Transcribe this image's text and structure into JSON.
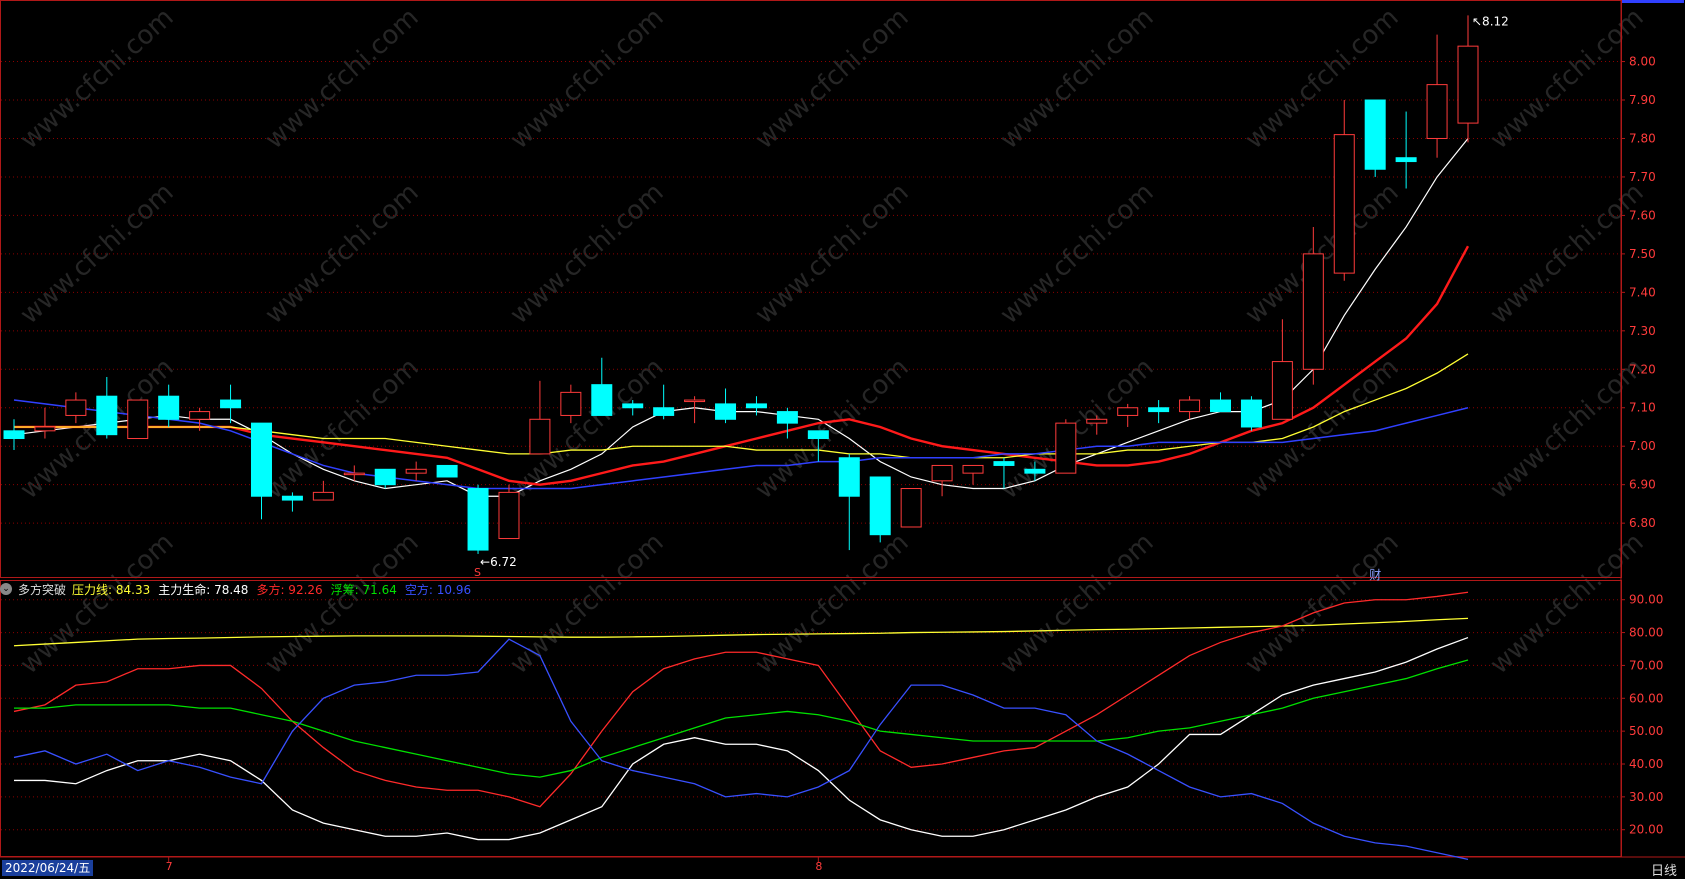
{
  "colors": {
    "up": "#ff3b3b",
    "down": "#00ffff",
    "ma5": "#ffffff",
    "ma10": "#ff1a1a",
    "ma20": "#ffff33",
    "ma60": "#3040ff",
    "grid": "#8b0000",
    "axis": "#b01818"
  },
  "watermark": "www.cfchi.com",
  "indicator": {
    "name": "多方突破",
    "items": [
      {
        "label": "压力线:",
        "value": "84.33",
        "color": "#ffff33"
      },
      {
        "label": "主力生命:",
        "value": "78.48",
        "color": "#ffffff"
      },
      {
        "label": "多方:",
        "value": "92.26",
        "color": "#ff2a2a"
      },
      {
        "label": "浮筹:",
        "value": "71.64",
        "color": "#00e000"
      },
      {
        "label": "空方:",
        "value": "10.96",
        "color": "#3850ff"
      }
    ]
  },
  "footer": {
    "date": "2022/06/24/五",
    "period": "日线",
    "month_labels": [
      "7",
      "8"
    ]
  },
  "markers": {
    "s_label": "S",
    "cai_label": "财",
    "high_label": "8.12",
    "low_label": "6.72"
  },
  "chart_data": [
    {
      "type": "candlestick",
      "title": "",
      "ylim": [
        6.66,
        8.16
      ],
      "y_ticks": [
        8.0,
        7.9,
        7.8,
        7.7,
        7.6,
        7.5,
        7.4,
        7.3,
        7.2,
        7.1,
        7.0,
        6.9,
        6.8
      ],
      "candles": [
        {
          "o": 7.04,
          "h": 7.07,
          "l": 6.99,
          "c": 7.02
        },
        {
          "o": 7.04,
          "h": 7.1,
          "l": 7.02,
          "c": 7.05
        },
        {
          "o": 7.08,
          "h": 7.14,
          "l": 7.06,
          "c": 7.12
        },
        {
          "o": 7.13,
          "h": 7.18,
          "l": 7.02,
          "c": 7.03
        },
        {
          "o": 7.02,
          "h": 7.12,
          "l": 7.02,
          "c": 7.12
        },
        {
          "o": 7.13,
          "h": 7.16,
          "l": 7.05,
          "c": 7.07
        },
        {
          "o": 7.07,
          "h": 7.1,
          "l": 7.04,
          "c": 7.09
        },
        {
          "o": 7.12,
          "h": 7.16,
          "l": 7.06,
          "c": 7.1
        },
        {
          "o": 7.06,
          "h": 7.06,
          "l": 6.81,
          "c": 6.87
        },
        {
          "o": 6.87,
          "h": 6.88,
          "l": 6.83,
          "c": 6.86
        },
        {
          "o": 6.86,
          "h": 6.91,
          "l": 6.86,
          "c": 6.88
        },
        {
          "o": 6.93,
          "h": 6.95,
          "l": 6.91,
          "c": 6.93
        },
        {
          "o": 6.94,
          "h": 6.94,
          "l": 6.89,
          "c": 6.9
        },
        {
          "o": 6.93,
          "h": 6.96,
          "l": 6.91,
          "c": 6.94
        },
        {
          "o": 6.95,
          "h": 6.95,
          "l": 6.92,
          "c": 6.92
        },
        {
          "o": 6.89,
          "h": 6.9,
          "l": 6.72,
          "c": 6.73
        },
        {
          "o": 6.76,
          "h": 6.9,
          "l": 6.76,
          "c": 6.88
        },
        {
          "o": 6.98,
          "h": 7.17,
          "l": 6.98,
          "c": 7.07
        },
        {
          "o": 7.08,
          "h": 7.16,
          "l": 7.06,
          "c": 7.14
        },
        {
          "o": 7.16,
          "h": 7.23,
          "l": 7.08,
          "c": 7.08
        },
        {
          "o": 7.11,
          "h": 7.12,
          "l": 7.08,
          "c": 7.1
        },
        {
          "o": 7.1,
          "h": 7.16,
          "l": 7.07,
          "c": 7.08
        },
        {
          "o": 7.12,
          "h": 7.13,
          "l": 7.06,
          "c": 7.12
        },
        {
          "o": 7.11,
          "h": 7.15,
          "l": 7.06,
          "c": 7.07
        },
        {
          "o": 7.11,
          "h": 7.13,
          "l": 7.08,
          "c": 7.1
        },
        {
          "o": 7.09,
          "h": 7.1,
          "l": 7.02,
          "c": 7.06
        },
        {
          "o": 7.04,
          "h": 7.04,
          "l": 6.96,
          "c": 7.02
        },
        {
          "o": 6.97,
          "h": 6.98,
          "l": 6.73,
          "c": 6.87
        },
        {
          "o": 6.92,
          "h": 6.92,
          "l": 6.75,
          "c": 6.77
        },
        {
          "o": 6.79,
          "h": 6.89,
          "l": 6.79,
          "c": 6.89
        },
        {
          "o": 6.91,
          "h": 6.95,
          "l": 6.87,
          "c": 6.95
        },
        {
          "o": 6.93,
          "h": 6.95,
          "l": 6.9,
          "c": 6.95
        },
        {
          "o": 6.96,
          "h": 6.97,
          "l": 6.89,
          "c": 6.95
        },
        {
          "o": 6.94,
          "h": 6.96,
          "l": 6.91,
          "c": 6.93
        },
        {
          "o": 6.93,
          "h": 7.07,
          "l": 6.93,
          "c": 7.06
        },
        {
          "o": 7.06,
          "h": 7.08,
          "l": 7.03,
          "c": 7.07
        },
        {
          "o": 7.08,
          "h": 7.11,
          "l": 7.05,
          "c": 7.1
        },
        {
          "o": 7.1,
          "h": 7.12,
          "l": 7.06,
          "c": 7.09
        },
        {
          "o": 7.09,
          "h": 7.13,
          "l": 7.07,
          "c": 7.12
        },
        {
          "o": 7.12,
          "h": 7.14,
          "l": 7.09,
          "c": 7.09
        },
        {
          "o": 7.12,
          "h": 7.13,
          "l": 7.04,
          "c": 7.05
        },
        {
          "o": 7.07,
          "h": 7.33,
          "l": 7.07,
          "c": 7.22
        },
        {
          "o": 7.2,
          "h": 7.57,
          "l": 7.16,
          "c": 7.5
        },
        {
          "o": 7.45,
          "h": 7.9,
          "l": 7.43,
          "c": 7.81
        },
        {
          "o": 7.9,
          "h": 7.9,
          "l": 7.7,
          "c": 7.72
        },
        {
          "o": 7.75,
          "h": 7.87,
          "l": 7.67,
          "c": 7.74
        },
        {
          "o": 7.8,
          "h": 8.07,
          "l": 7.75,
          "c": 7.94
        },
        {
          "o": 7.84,
          "h": 8.12,
          "l": 7.79,
          "c": 8.04
        }
      ],
      "series": [
        {
          "name": "ma5",
          "values": [
            7.03,
            7.04,
            7.05,
            7.06,
            7.07,
            7.08,
            7.07,
            7.07,
            7.03,
            6.98,
            6.94,
            6.91,
            6.89,
            6.9,
            6.91,
            6.87,
            6.87,
            6.91,
            6.94,
            6.98,
            7.05,
            7.09,
            7.1,
            7.09,
            7.09,
            7.08,
            7.07,
            7.02,
            6.96,
            6.92,
            6.9,
            6.89,
            6.89,
            6.91,
            6.95,
            6.98,
            7.01,
            7.04,
            7.07,
            7.09,
            7.09,
            7.12,
            7.2,
            7.34,
            7.46,
            7.57,
            7.7,
            7.8
          ]
        },
        {
          "name": "ma10",
          "values": [
            7.05,
            7.05,
            7.05,
            7.05,
            7.05,
            7.05,
            7.05,
            7.05,
            7.03,
            7.02,
            7.01,
            7.0,
            6.99,
            6.98,
            6.97,
            6.94,
            6.91,
            6.9,
            6.91,
            6.93,
            6.95,
            6.96,
            6.98,
            7.0,
            7.02,
            7.04,
            7.06,
            7.07,
            7.05,
            7.02,
            7.0,
            6.99,
            6.98,
            6.97,
            6.96,
            6.95,
            6.95,
            6.96,
            6.98,
            7.01,
            7.04,
            7.06,
            7.1,
            7.16,
            7.22,
            7.28,
            7.37,
            7.52
          ]
        },
        {
          "name": "ma20",
          "values": [
            7.05,
            7.05,
            7.05,
            7.05,
            7.05,
            7.05,
            7.05,
            7.05,
            7.04,
            7.03,
            7.02,
            7.02,
            7.02,
            7.01,
            7.0,
            6.99,
            6.98,
            6.98,
            6.99,
            6.99,
            7.0,
            7.0,
            7.0,
            7.0,
            6.99,
            6.99,
            6.99,
            6.98,
            6.98,
            6.97,
            6.97,
            6.97,
            6.97,
            6.98,
            6.98,
            6.98,
            6.99,
            6.99,
            7.0,
            7.01,
            7.01,
            7.02,
            7.05,
            7.09,
            7.12,
            7.15,
            7.19,
            7.24
          ]
        },
        {
          "name": "ma60",
          "values": [
            7.12,
            7.11,
            7.1,
            7.09,
            7.08,
            7.07,
            7.06,
            7.04,
            7.01,
            6.98,
            6.95,
            6.93,
            6.92,
            6.91,
            6.9,
            6.89,
            6.89,
            6.89,
            6.89,
            6.9,
            6.91,
            6.92,
            6.93,
            6.94,
            6.95,
            6.95,
            6.96,
            6.96,
            6.97,
            6.97,
            6.97,
            6.97,
            6.98,
            6.98,
            6.99,
            7.0,
            7.0,
            7.01,
            7.01,
            7.01,
            7.01,
            7.01,
            7.02,
            7.03,
            7.04,
            7.06,
            7.08,
            7.1
          ]
        }
      ]
    },
    {
      "type": "line",
      "title": "",
      "ylim": [
        12,
        96
      ],
      "y_ticks": [
        90,
        80,
        70,
        60,
        50,
        40,
        30,
        20
      ],
      "series": [
        {
          "name": "压力线",
          "values": [
            76,
            76.5,
            77,
            77.5,
            78,
            78.2,
            78.3,
            78.5,
            78.7,
            78.8,
            78.9,
            79,
            79,
            79,
            79,
            78.9,
            78.8,
            78.7,
            78.6,
            78.6,
            78.7,
            78.8,
            79,
            79.2,
            79.4,
            79.5,
            79.6,
            79.7,
            79.8,
            80,
            80.1,
            80.2,
            80.3,
            80.5,
            80.7,
            80.9,
            81,
            81.2,
            81.4,
            81.6,
            81.8,
            82,
            82.2,
            82.6,
            83,
            83.4,
            83.9,
            84.33
          ]
        },
        {
          "name": "主力生命",
          "values": [
            35,
            35,
            34,
            38,
            41,
            41,
            43,
            41,
            35,
            26,
            22,
            20,
            18,
            18,
            19,
            17,
            17,
            19,
            23,
            27,
            40,
            46,
            48,
            46,
            46,
            44,
            38,
            29,
            23,
            20,
            18,
            18,
            20,
            23,
            26,
            30,
            33,
            40,
            49,
            49,
            55,
            61,
            64,
            66,
            68,
            71,
            75,
            78.48
          ]
        },
        {
          "name": "多方",
          "values": [
            56,
            58,
            64,
            65,
            69,
            69,
            70,
            70,
            63,
            53,
            45,
            38,
            35,
            33,
            32,
            32,
            30,
            27,
            37,
            50,
            62,
            69,
            72,
            74,
            74,
            72,
            70,
            57,
            44,
            39,
            40,
            42,
            44,
            45,
            50,
            55,
            61,
            67,
            73,
            77,
            80,
            82,
            86,
            89,
            90,
            90,
            91,
            92.26
          ]
        },
        {
          "name": "浮筹",
          "values": [
            57,
            57,
            58,
            58,
            58,
            58,
            57,
            57,
            55,
            53,
            50,
            47,
            45,
            43,
            41,
            39,
            37,
            36,
            38,
            42,
            45,
            48,
            51,
            54,
            55,
            56,
            55,
            53,
            50,
            49,
            48,
            47,
            47,
            47,
            47,
            47,
            48,
            50,
            51,
            53,
            55,
            57,
            60,
            62,
            64,
            66,
            69,
            71.64
          ]
        },
        {
          "name": "空方",
          "values": [
            42,
            44,
            40,
            43,
            38,
            41,
            39,
            36,
            34,
            50,
            60,
            64,
            65,
            67,
            67,
            68,
            78,
            73,
            53,
            41,
            38,
            36,
            34,
            30,
            31,
            30,
            33,
            38,
            52,
            64,
            64,
            61,
            57,
            57,
            55,
            47,
            43,
            38,
            33,
            30,
            31,
            28,
            22,
            18,
            16,
            15,
            13,
            10.96
          ]
        }
      ]
    }
  ]
}
